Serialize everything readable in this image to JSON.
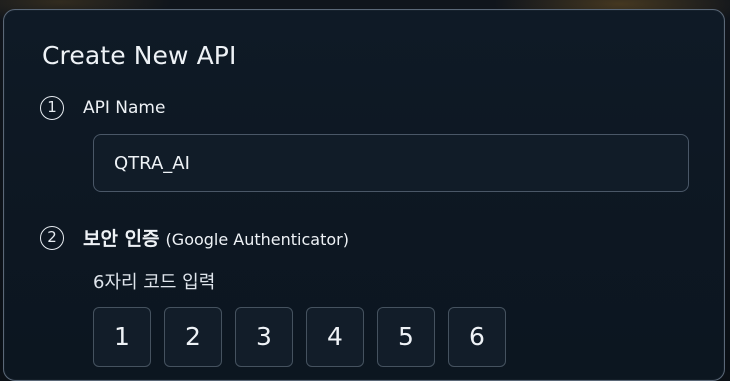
{
  "dialog": {
    "title": "Create New API"
  },
  "step1": {
    "number": "1",
    "label": "API Name",
    "input_value": "QTRA_AI"
  },
  "step2": {
    "number": "2",
    "label_ko": "보안 인증",
    "label_paren": "(Google Authenticator)",
    "code_hint": "6자리 코드 입력",
    "code_digits": [
      "1",
      "2",
      "3",
      "4",
      "5",
      "6"
    ]
  },
  "colors": {
    "panel_border": "#5b6878",
    "panel_bg": "#0f1a26",
    "text": "#eef2f6"
  }
}
